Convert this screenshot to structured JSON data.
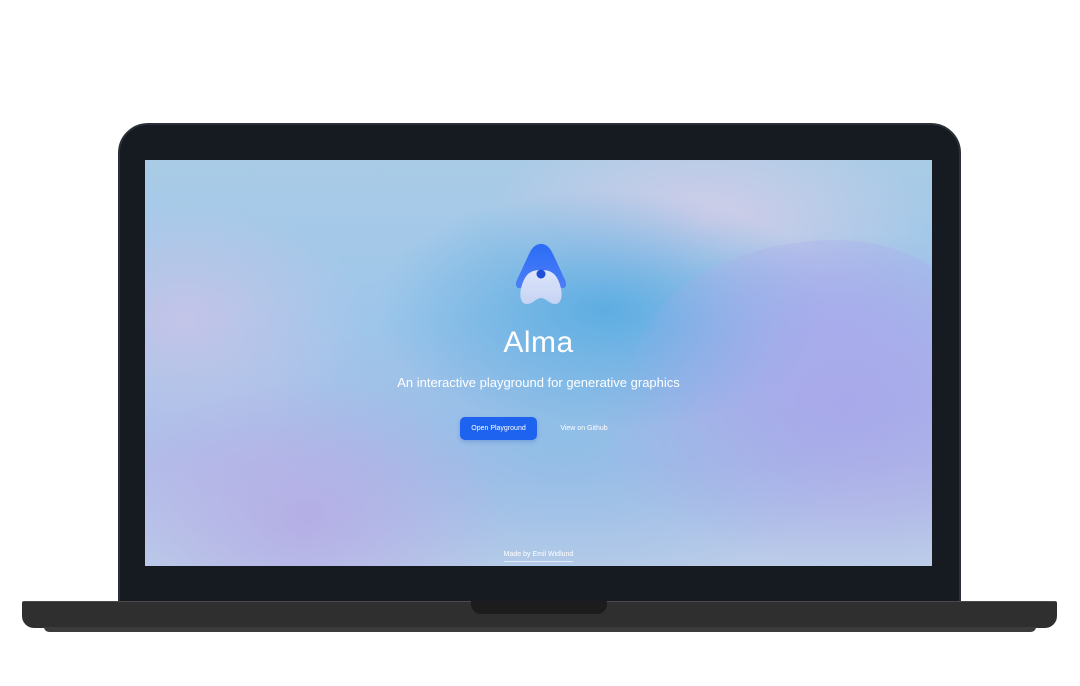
{
  "app": {
    "name": "Alma",
    "tagline": "An interactive playground for generative graphics"
  },
  "actions": {
    "primary_label": "Open Playground",
    "secondary_label": "View on Github"
  },
  "footer": {
    "credit": "Made by Emil Widlund"
  },
  "colors": {
    "accent": "#1e62f0",
    "bezel": "#161b22",
    "base": "#2f2f2f"
  },
  "icons": {
    "logo": "alma-logo-icon"
  }
}
